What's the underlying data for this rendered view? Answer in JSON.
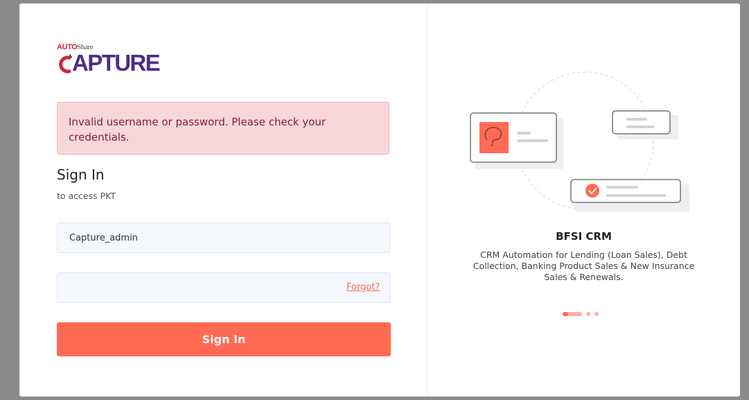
{
  "logo": {
    "auto": "AUTO",
    "share": "Share",
    "main": "APTURE",
    "alt": "AutoShare Capture"
  },
  "alert": {
    "message": "Invalid username or password. Please check your credentials."
  },
  "signin": {
    "title": "Sign In",
    "subtitle": "to access PKT",
    "username_value": "Capture_admin",
    "password_value": "",
    "forgot_label": "Forgot?",
    "button_label": "Sign In"
  },
  "carousel": {
    "title": "BFSI CRM",
    "description": "CRM Automation for Lending (Loan Sales), Debt Collection, Banking Product Sales & New Insurance Sales & Renewals.",
    "slide_count": 3,
    "active_slide": 1
  },
  "colors": {
    "accent": "#ff6a55",
    "alert_bg": "#f8d7da",
    "alert_text": "#842029",
    "brand_purple": "#4c2d86",
    "brand_red": "#d3263a"
  }
}
